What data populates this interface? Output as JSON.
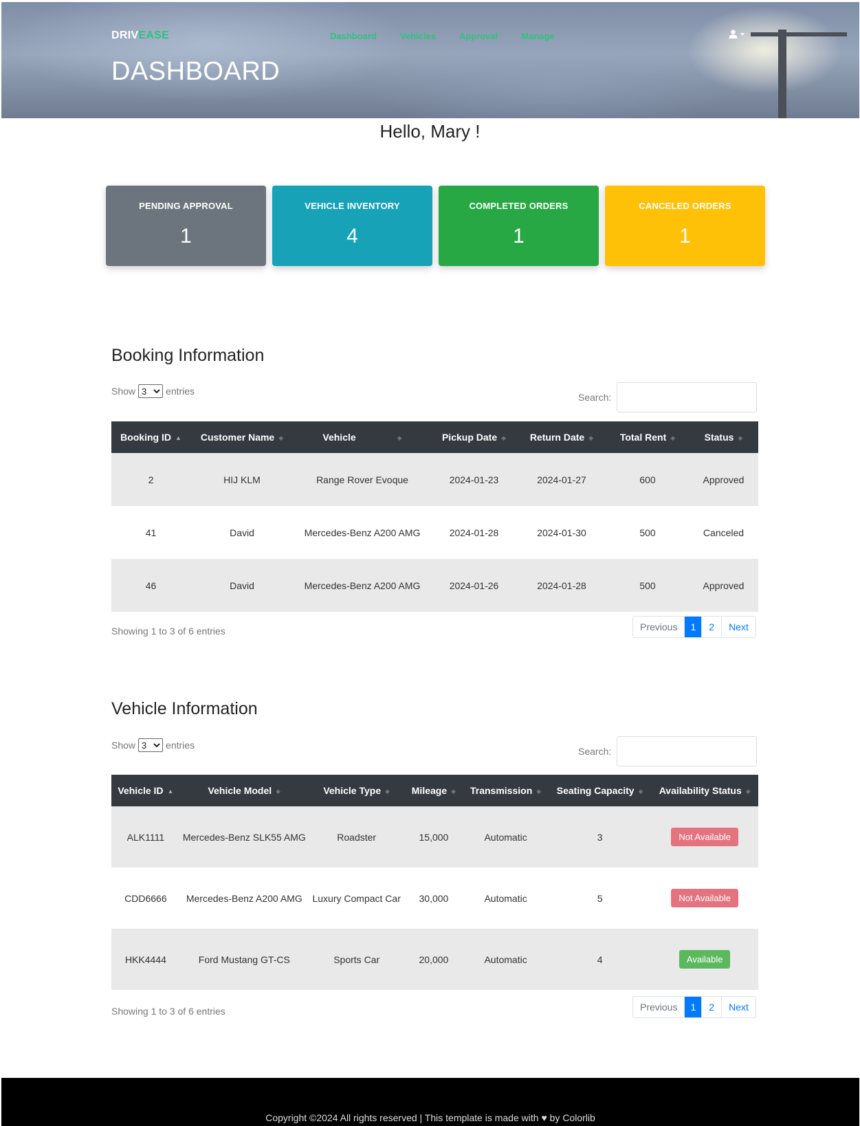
{
  "brand": {
    "part1": "DRIV",
    "part2": "EASE"
  },
  "nav": [
    {
      "label": "Dashboard"
    },
    {
      "label": "Vehicles"
    },
    {
      "label": "Approval"
    },
    {
      "label": "Manage"
    }
  ],
  "hero": {
    "title": "DASHBOARD"
  },
  "greeting": "Hello, Mary !",
  "cards": [
    {
      "label": "PENDING APPROVAL",
      "value": "1"
    },
    {
      "label": "VEHICLE INVENTORY",
      "value": "4"
    },
    {
      "label": "COMPLETED ORDERS",
      "value": "1"
    },
    {
      "label": "CANCELED ORDERS",
      "value": "1"
    }
  ],
  "booking": {
    "title": "Booking Information",
    "show_prefix": "Show",
    "show_value": "3",
    "show_suffix": "entries",
    "search_label": "Search:",
    "columns": [
      "Booking ID",
      "Customer Name",
      "Vehicle",
      "Pickup Date",
      "Return Date",
      "Total Rent",
      "Status"
    ],
    "rows": [
      [
        "2",
        "HIJ KLM",
        "Range Rover Evoque",
        "2024-01-23",
        "2024-01-27",
        "600",
        "Approved"
      ],
      [
        "41",
        "David",
        "Mercedes-Benz A200 AMG",
        "2024-01-28",
        "2024-01-30",
        "500",
        "Canceled"
      ],
      [
        "46",
        "David",
        "Mercedes-Benz A200 AMG",
        "2024-01-26",
        "2024-01-28",
        "500",
        "Approved"
      ]
    ],
    "showing": "Showing 1 to 3 of 6 entries",
    "pager": {
      "prev": "Previous",
      "p1": "1",
      "p2": "2",
      "next": "Next"
    }
  },
  "vehicles": {
    "title": "Vehicle Information",
    "show_prefix": "Show",
    "show_value": "3",
    "show_suffix": "entries",
    "search_label": "Search:",
    "columns": [
      "Vehicle ID",
      "Vehicle Model",
      "Vehicle Type",
      "Mileage",
      "Transmission",
      "Seating Capacity",
      "Availability Status"
    ],
    "rows": [
      [
        "ALK1111",
        "Mercedes-Benz SLK55 AMG",
        "Roadster",
        "15,000",
        "Automatic",
        "3",
        "Not Available"
      ],
      [
        "CDD6666",
        "Mercedes-Benz A200 AMG",
        "Luxury Compact Car",
        "30,000",
        "Automatic",
        "5",
        "Not Available"
      ],
      [
        "HKK4444",
        "Ford Mustang GT-CS",
        "Sports Car",
        "20,000",
        "Automatic",
        "4",
        "Available"
      ]
    ],
    "showing": "Showing 1 to 3 of 6 entries",
    "pager": {
      "prev": "Previous",
      "p1": "1",
      "p2": "2",
      "next": "Next"
    }
  },
  "footer": {
    "before": "Copyright ©2024 All rights reserved | This template is made with",
    "after": "by Colorlib"
  },
  "colors": {
    "accent": "#2ec27e",
    "pending": "#6c757d",
    "inventory": "#17a2b8",
    "completed": "#28a745",
    "canceled": "#ffc107",
    "not_available": "#e3747f",
    "available": "#5cb85c"
  },
  "icons": {
    "user": "user-icon",
    "heart": "heart-icon"
  }
}
